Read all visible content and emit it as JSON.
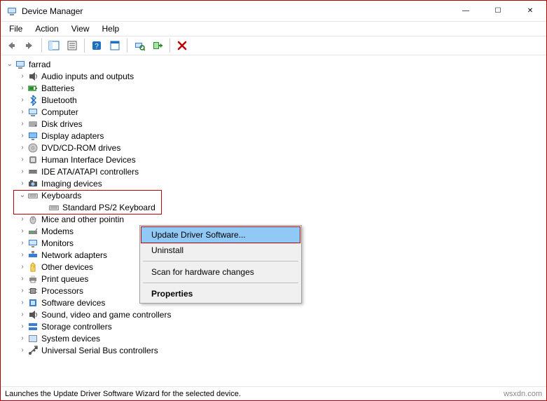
{
  "window": {
    "title": "Device Manager"
  },
  "menubar": [
    "File",
    "Action",
    "View",
    "Help"
  ],
  "tree": {
    "root": "farrad",
    "items": [
      {
        "label": "Audio inputs and outputs",
        "icon": "audio"
      },
      {
        "label": "Batteries",
        "icon": "battery"
      },
      {
        "label": "Bluetooth",
        "icon": "bluetooth"
      },
      {
        "label": "Computer",
        "icon": "computer"
      },
      {
        "label": "Disk drives",
        "icon": "disk"
      },
      {
        "label": "Display adapters",
        "icon": "display"
      },
      {
        "label": "DVD/CD-ROM drives",
        "icon": "dvd"
      },
      {
        "label": "Human Interface Devices",
        "icon": "hid"
      },
      {
        "label": "IDE ATA/ATAPI controllers",
        "icon": "ide"
      },
      {
        "label": "Imaging devices",
        "icon": "imaging"
      },
      {
        "label": "Keyboards",
        "icon": "keyboard",
        "expanded": true,
        "children": [
          {
            "label": "Standard PS/2 Keyboard",
            "icon": "keyboard"
          }
        ]
      },
      {
        "label": "Mice and other pointin",
        "icon": "mouse"
      },
      {
        "label": "Modems",
        "icon": "modem"
      },
      {
        "label": "Monitors",
        "icon": "monitor"
      },
      {
        "label": "Network adapters",
        "icon": "network"
      },
      {
        "label": "Other devices",
        "icon": "other"
      },
      {
        "label": "Print queues",
        "icon": "printer"
      },
      {
        "label": "Processors",
        "icon": "cpu"
      },
      {
        "label": "Software devices",
        "icon": "software"
      },
      {
        "label": "Sound, video and game controllers",
        "icon": "sound"
      },
      {
        "label": "Storage controllers",
        "icon": "storage"
      },
      {
        "label": "System devices",
        "icon": "system"
      },
      {
        "label": "Universal Serial Bus controllers",
        "icon": "usb"
      }
    ]
  },
  "context_menu": {
    "items": [
      {
        "label": "Update Driver Software...",
        "highlight": true
      },
      {
        "label": "Uninstall"
      },
      {
        "sep": true
      },
      {
        "label": "Scan for hardware changes"
      },
      {
        "sep": true
      },
      {
        "label": "Properties",
        "bold": true
      }
    ]
  },
  "statusbar": {
    "text": "Launches the Update Driver Software Wizard for the selected device.",
    "watermark": "wsxdn.com"
  },
  "window_controls": {
    "min": "—",
    "max": "☐",
    "close": "✕"
  }
}
